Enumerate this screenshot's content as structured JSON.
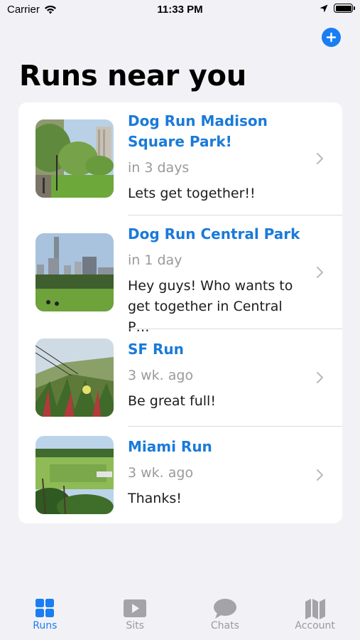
{
  "status_bar": {
    "carrier": "Carrier",
    "time": "11:33 PM"
  },
  "header": {
    "title": "Runs near you",
    "add_icon": "plus-circle-icon"
  },
  "runs": [
    {
      "title": "Dog Run Madison Square Park!",
      "when": "in 3 days",
      "message": "Lets get together!!"
    },
    {
      "title": "Dog Run Central Park",
      "when": "in 1 day",
      "message": "Hey guys! Who wants to get together in Central P…"
    },
    {
      "title": "SF Run",
      "when": "3 wk. ago",
      "message": "Be great full!"
    },
    {
      "title": "Miami Run",
      "when": "3 wk. ago",
      "message": "Thanks!"
    }
  ],
  "tabs": [
    {
      "label": "Runs",
      "icon": "grid-icon",
      "active": true
    },
    {
      "label": "Sits",
      "icon": "play-icon",
      "active": false
    },
    {
      "label": "Chats",
      "icon": "chat-bubble-icon",
      "active": false
    },
    {
      "label": "Account",
      "icon": "map-icon",
      "active": false
    }
  ],
  "colors": {
    "accent": "#1a7ef2",
    "title_blue": "#1a7ad9",
    "background": "#f2f2f6"
  }
}
